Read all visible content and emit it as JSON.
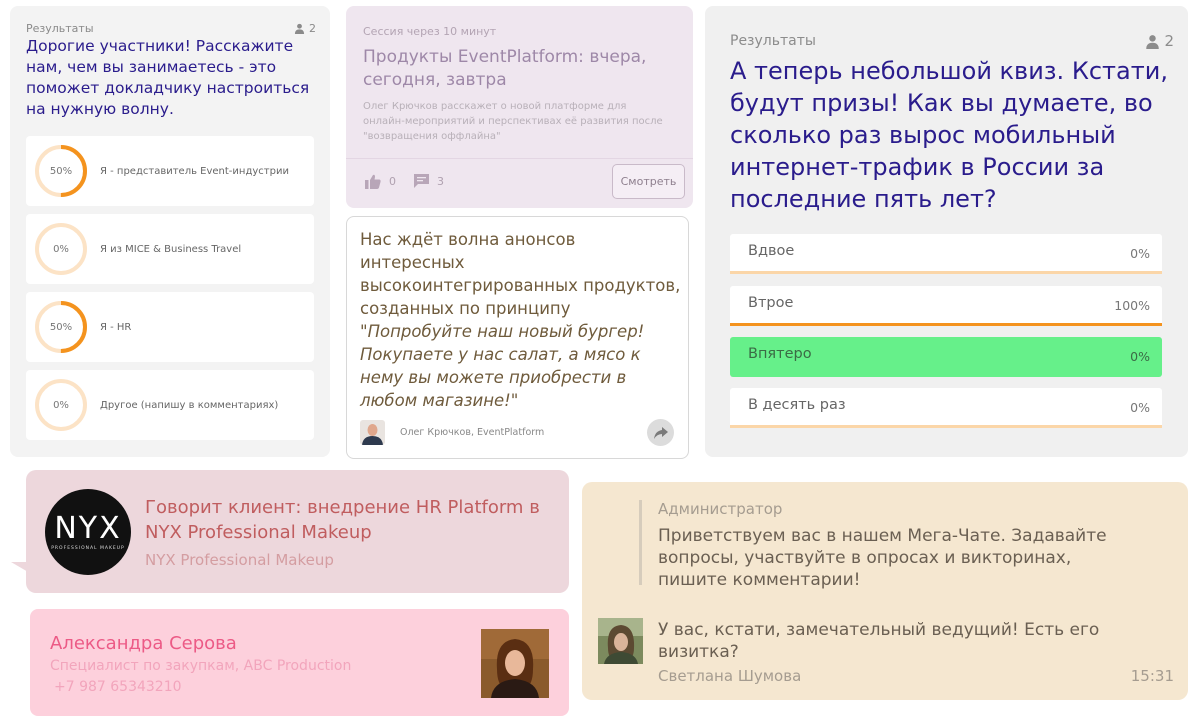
{
  "poll": {
    "results_label": "Результаты",
    "participants": "2",
    "question": "Дорогие участники! Расскажите нам, чем вы занимаетесь - это поможет докладчику настроиться на нужную волну.",
    "options": [
      {
        "percent": "50%",
        "fraction": 0.5,
        "label": "Я - представитель Event-индустрии"
      },
      {
        "percent": "0%",
        "fraction": 0,
        "label": "Я из MICE & Business Travel"
      },
      {
        "percent": "50%",
        "fraction": 0.5,
        "label": "Я - HR"
      },
      {
        "percent": "0%",
        "fraction": 0,
        "label": "Другое (напишу в комментариях)"
      }
    ],
    "ring_color": "#f4931e",
    "ring_track_color": "#fce3c6"
  },
  "session": {
    "starts_in": "Сессия через 10 минут",
    "title": "Продукты EventPlatform: вчера, сегодня, завтра",
    "description": "Олег Крючков расскажет о новой платформе для онлайн-мероприятий и перспективах её развития после \"возвращения оффлайна\"",
    "likes": "0",
    "comments": "3",
    "watch_label": "Смотреть"
  },
  "quote": {
    "text_plain": "Нас ждёт волна анонсов интересных высокоинтегрированных продуктов, созданных по принципу",
    "text_italic": "\"Попробуйте наш новый бургер! Покупаете у нас салат, а мясо к нему вы можете приобрести в любом магазине!\"",
    "author": "Олег Крючков, EventPlatform"
  },
  "quiz": {
    "results_label": "Результаты",
    "participants": "2",
    "question": "А теперь небольшой квиз. Кстати, будут призы! Как вы думаете, во сколько раз вырос мобильный интернет-трафик в России за последние пять лет?",
    "options": [
      {
        "label": "Вдвое",
        "percent": "0%",
        "fraction": 0,
        "correct": false
      },
      {
        "label": "Втрое",
        "percent": "100%",
        "fraction": 1,
        "correct": false
      },
      {
        "label": "Впятеро",
        "percent": "0%",
        "fraction": 0,
        "correct": true
      },
      {
        "label": "В десять раз",
        "percent": "0%",
        "fraction": 0,
        "correct": false
      }
    ],
    "bar_color": "#f4931e",
    "bar_track_color": "#fbd6a8",
    "correct_color": "#66f08a"
  },
  "client": {
    "title": "Говорит клиент: внедрение HR Platform в NYX Professional Makeup",
    "source": "NYX Professional Makeup",
    "logo_text": "NYX",
    "logo_subtext": "PROFESSIONAL MAKEUP"
  },
  "contact": {
    "name": "Александра Серова",
    "role": "Специалист по закупкам, ABC Production",
    "phone": "+7 987 65343210"
  },
  "chat": {
    "admin_label": "Администратор",
    "admin_message": "Приветствуем вас в нашем Мега-Чате. Задавайте вопросы, участвуйте в опросах и викторинах, пишите комментарии!",
    "message": "У вас, кстати, замечательный ведущий! Есть его визитка?",
    "sender": "Светлана Шумова",
    "time": "15:31"
  }
}
